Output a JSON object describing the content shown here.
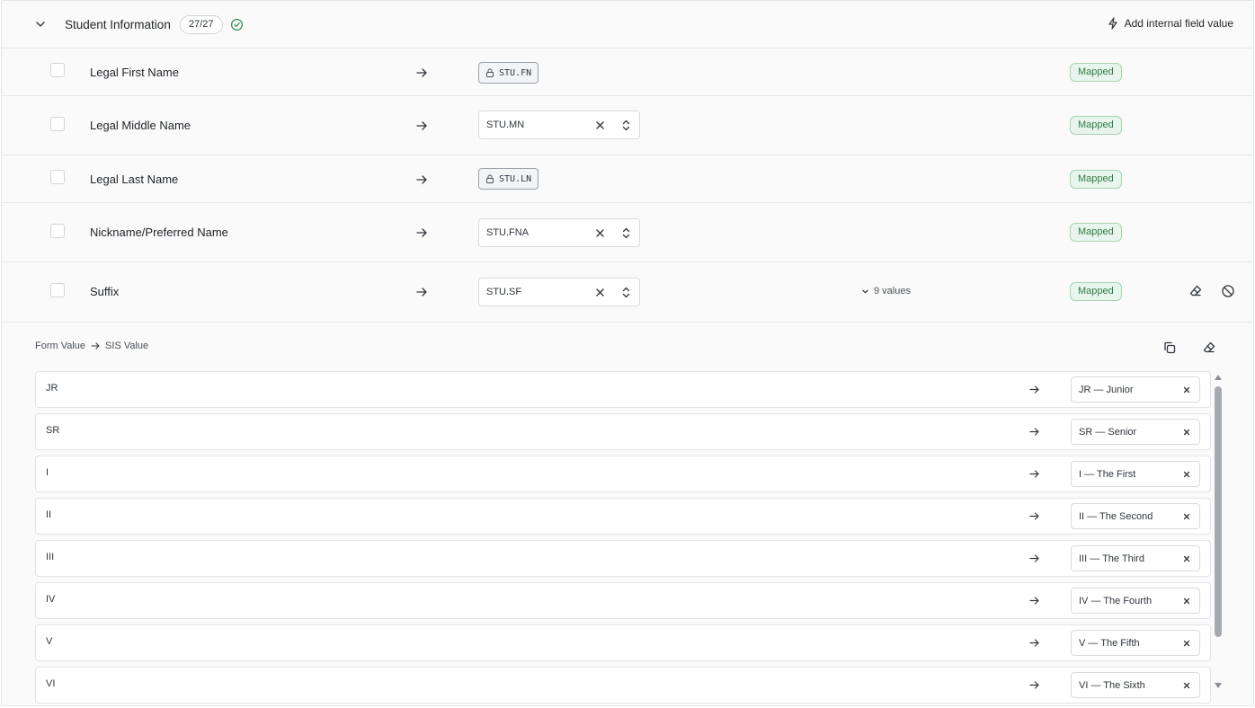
{
  "section": {
    "title": "Student Information",
    "count": "27/27",
    "add_button_label": "Add internal field value"
  },
  "fields": [
    {
      "label": "Legal First Name",
      "mapping": "STU.FN",
      "locked": true,
      "status": "Mapped"
    },
    {
      "label": "Legal Middle Name",
      "mapping": "STU.MN",
      "locked": false,
      "status": "Mapped"
    },
    {
      "label": "Legal Last Name",
      "mapping": "STU.LN",
      "locked": true,
      "status": "Mapped"
    },
    {
      "label": "Nickname/Preferred Name",
      "mapping": "STU.FNA",
      "locked": false,
      "status": "Mapped"
    },
    {
      "label": "Suffix",
      "mapping": "STU.SF",
      "locked": false,
      "status": "Mapped",
      "values_toggle": "9 values"
    }
  ],
  "value_panel": {
    "form_value_label": "Form Value",
    "sis_value_label": "SIS Value",
    "rows": [
      {
        "form": "JR",
        "sis": "JR — Junior"
      },
      {
        "form": "SR",
        "sis": "SR — Senior"
      },
      {
        "form": "I",
        "sis": "I — The First"
      },
      {
        "form": "II",
        "sis": "II — The Second"
      },
      {
        "form": "III",
        "sis": "III — The Third"
      },
      {
        "form": "IV",
        "sis": "IV — The Fourth"
      },
      {
        "form": "V",
        "sis": "V — The Fifth"
      },
      {
        "form": "VI",
        "sis": "VI — The Sixth"
      }
    ]
  },
  "icons": {
    "collapse": "chevron-down-icon",
    "complete": "check-circle-icon",
    "add": "lightning-icon",
    "arrow": "arrow-right-icon",
    "lock": "lock-icon",
    "clear": "close-icon",
    "stepper": "chevron-up-down-icon",
    "eraser": "eraser-icon",
    "disable": "ban-icon",
    "copy": "copy-icon"
  },
  "colors": {
    "mapped_text": "#2f7a45",
    "mapped_bg": "#e8f5ec",
    "mapped_border": "#a8d5b3",
    "check_green": "#2f8a4d"
  }
}
